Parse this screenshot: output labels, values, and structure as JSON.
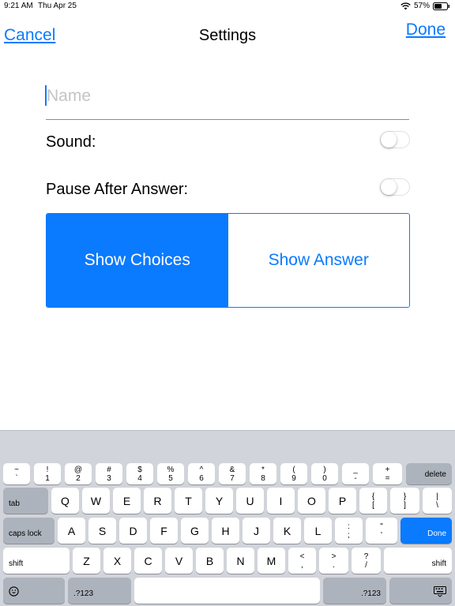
{
  "status_bar": {
    "time": "9:21 AM",
    "date": "Thu Apr 25",
    "battery": "57%",
    "icons": [
      "wifi-icon",
      "battery-icon"
    ]
  },
  "nav": {
    "cancel": "Cancel",
    "title": "Settings",
    "done": "Done"
  },
  "form": {
    "name_placeholder": "Name",
    "name_value": "",
    "sound_label": "Sound:",
    "sound_on": false,
    "pause_label": "Pause After Answer:",
    "pause_on": false,
    "segments": [
      "Show Choices",
      "Show Answer"
    ],
    "selected_segment": "Show Choices"
  },
  "colors": {
    "accent": "#0a7aff",
    "keyboard_bg": "#d1d4da",
    "key_dark": "#adb3bc"
  },
  "keyboard": {
    "number_row": [
      {
        "top": "~",
        "bottom": "`"
      },
      {
        "top": "!",
        "bottom": "1"
      },
      {
        "top": "@",
        "bottom": "2"
      },
      {
        "top": "#",
        "bottom": "3"
      },
      {
        "top": "$",
        "bottom": "4"
      },
      {
        "top": "%",
        "bottom": "5"
      },
      {
        "top": "^",
        "bottom": "6"
      },
      {
        "top": "&",
        "bottom": "7"
      },
      {
        "top": "*",
        "bottom": "8"
      },
      {
        "top": "(",
        "bottom": "9"
      },
      {
        "top": ")",
        "bottom": "0"
      },
      {
        "top": "_",
        "bottom": "-"
      },
      {
        "top": "+",
        "bottom": "="
      }
    ],
    "delete": "delete",
    "tab": "tab",
    "row_q": [
      "Q",
      "W",
      "E",
      "R",
      "T",
      "Y",
      "U",
      "I",
      "O",
      "P"
    ],
    "row_q_punct": [
      {
        "top": "{",
        "bottom": "["
      },
      {
        "top": "}",
        "bottom": "]"
      },
      {
        "top": "|",
        "bottom": "\\"
      }
    ],
    "caps_lock": "caps lock",
    "row_a": [
      "A",
      "S",
      "D",
      "F",
      "G",
      "H",
      "J",
      "K",
      "L"
    ],
    "row_a_punct": [
      {
        "top": ":",
        "bottom": ";"
      },
      {
        "top": "\"",
        "bottom": "'"
      }
    ],
    "done": "Done",
    "shift_left": "shift",
    "row_z": [
      "Z",
      "X",
      "C",
      "V",
      "B",
      "N",
      "M"
    ],
    "row_z_punct": [
      {
        "top": "<",
        "bottom": ","
      },
      {
        "top": ">",
        "bottom": "."
      },
      {
        "top": "?",
        "bottom": "/"
      }
    ],
    "shift_right": "shift",
    "numbers_left": ".?123",
    "numbers_right": ".?123",
    "emoji_icon": "emoji-icon",
    "dismiss_icon": "keyboard-dismiss-icon"
  }
}
